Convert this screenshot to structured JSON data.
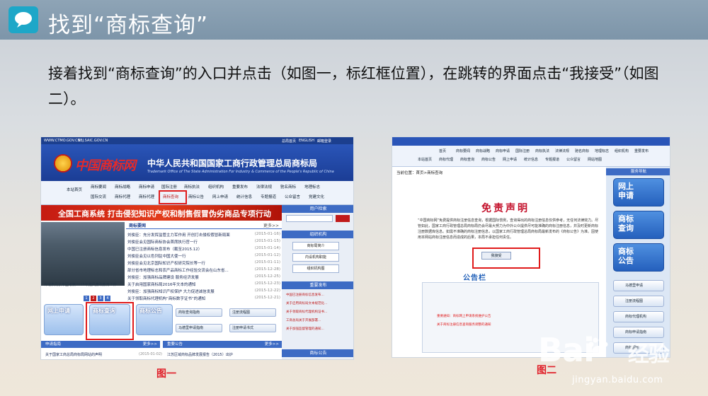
{
  "slide": {
    "title": "找到“商标查询”",
    "body": "接着找到“商标查询”的入口并点击（如图一，标红框位置），在跳转的界面点击“我接受”（如图二）。",
    "caption1": "图一",
    "caption2": "图二"
  },
  "shot1": {
    "top_links": [
      "WWW.CTMO.GOV.CN",
      "SBJ.SAIC.GOV.CN",
      "总局首页",
      "ENGLISH",
      "邮箱登录"
    ],
    "logo": "中国商标网",
    "bureau": "中华人民共和国国家工商行政管理总局商标局",
    "bureau_en": "Trademark Office of The State Administration For Industry & Commerce of the People's Republic of China",
    "nav_row1": [
      "本站首页",
      "商标要闻",
      "商标战略",
      "商标申请",
      "国际注册",
      "商标执法",
      "组织机构",
      "重要发布",
      "法律法规",
      "驰名商标",
      "地理标志"
    ],
    "nav_row2": [
      "国际交流",
      "商标代理",
      "商标代理",
      "商标查询",
      "商标公告",
      "网上申请",
      "统计信息",
      "专题报道",
      "公众留言",
      "党建文化"
    ],
    "banner": "全国工商系统 打击侵犯知识产权和制售假冒伪劣商品专项行动",
    "photo_caption": "许瑞表局长率团考察2015年党风廉政教育工作",
    "pager": [
      "1",
      "2",
      "3",
      "4"
    ],
    "news_head": "商标要闻",
    "news_more": "更多>>",
    "news": [
      {
        "text": "刘俊臣：充分发挥监管主力军作用 开创打击侵权假冒新局面",
        "date": "(2015-01-16)"
      },
      {
        "text": "刘俊臣会见国际商标协会首席执行官一行",
        "date": "(2015-01-15)"
      },
      {
        "text": "中国已注册商标信息发布（截至2015.12）",
        "date": "(2015-01-14)"
      },
      {
        "text": "刘俊臣会见以色列驻中国大使一行",
        "date": "(2015-01-12)"
      },
      {
        "text": "刘俊臣会见北京国际知识产权研究院长等一行",
        "date": "(2015-01-11)"
      },
      {
        "text": "部分省市地理标志和农产品商标工作经验交流会在山东省...",
        "date": "(2015-12-28)"
      },
      {
        "text": "刘俊臣：加强商标品牌建设 服务经济发展",
        "date": "(2015-12-25)"
      },
      {
        "text": "关于启用国家商标局2016年文本的通知",
        "date": "(2015-12-23)"
      },
      {
        "text": "刘俊臣：加强商标知识产权保护 大力促进诚信发展",
        "date": "(2015-12-22)"
      },
      {
        "text": "关于领取商标代理机构“商标数字证书”的通知",
        "date": "(2015-12-21)"
      }
    ],
    "tiles": [
      "网上申请",
      "商标查询",
      "商标公告"
    ],
    "pills": [
      "商标查询指南",
      "注册流程图",
      "马德里申请指南",
      "注册申请书式"
    ],
    "sidebar_heads": [
      "用户检索",
      "组织机构",
      "重要发布",
      "商标公告"
    ],
    "sidebar_btns": [
      "商标局简介",
      "内设机构职能",
      "组织机构图"
    ],
    "side_links": [
      "中国已注册商标信息发布...",
      "关于启用商标局文本规范化...",
      "关于领取商标代理机构证书...",
      "工商总局关于开展部署...",
      "关于加强监督管理的通知..."
    ],
    "bottom_heads": [
      "申请指南",
      "更多>>",
      "重要公告",
      "更多>>"
    ],
    "bottom_texts": [
      "关于国家工商总局商标局网站的声明",
      "(2015-01-02)",
      "江苏区域商标品牌发展报告（2015）出炉"
    ]
  },
  "shot2": {
    "nav_row1": [
      "首页",
      "商标要闻",
      "商标战略",
      "商标申请",
      "国际注册",
      "商标执法",
      "法律法规",
      "驰名商标",
      "地理标志",
      "组织机构",
      "重要发布"
    ],
    "nav_row2": [
      "本站首页",
      "商标代理",
      "商标查询",
      "商标公告",
      "网上申请",
      "统计信息",
      "专题报道",
      "公众留言",
      "网站地图"
    ],
    "crumb": "当前位置：首页>商标查询",
    "disclaimer_title": "免责声明",
    "disclaimer_text": "“中国商标网”免费提供商标注册信息查询，根据国际惯例，查询得出的商标注册信息仅供参考，无任何法律效力。尽管如此，国家工商行政管理总局商标局仍会尽最大努力为中外公众提供尽可能准确的商标注册信息，并及时更新商标注册数据库信息。如需不准确的商标注册信息，以国家工商行政管理总局商标局最新发布的《商标公告》为准。因使用本网站商标注册信息而造成的后果，本局不承担任何责任。",
    "accept_btn": "我接受",
    "board_title": "公告栏",
    "board_lines": [
      "重要通知：商标网上申请系统维护公告",
      "关于商标注册信息查询服务调整的通知"
    ],
    "side_head": "服务导航",
    "side_big": [
      "网上申请",
      "商标查询",
      "商标公告"
    ],
    "side_btns": [
      "马德里申请",
      "注册流程图",
      "商标代理机构",
      "商标申请指南",
      "商标图形"
    ]
  },
  "watermark": {
    "brand": "Bai",
    "brand2": "经验",
    "url": "jingyan.baidu.com"
  },
  "colors": {
    "title_bar": "#7f97ab",
    "accent": "#1da7c8",
    "red": "#e01b1b",
    "site_blue": "#1c3f8e"
  }
}
